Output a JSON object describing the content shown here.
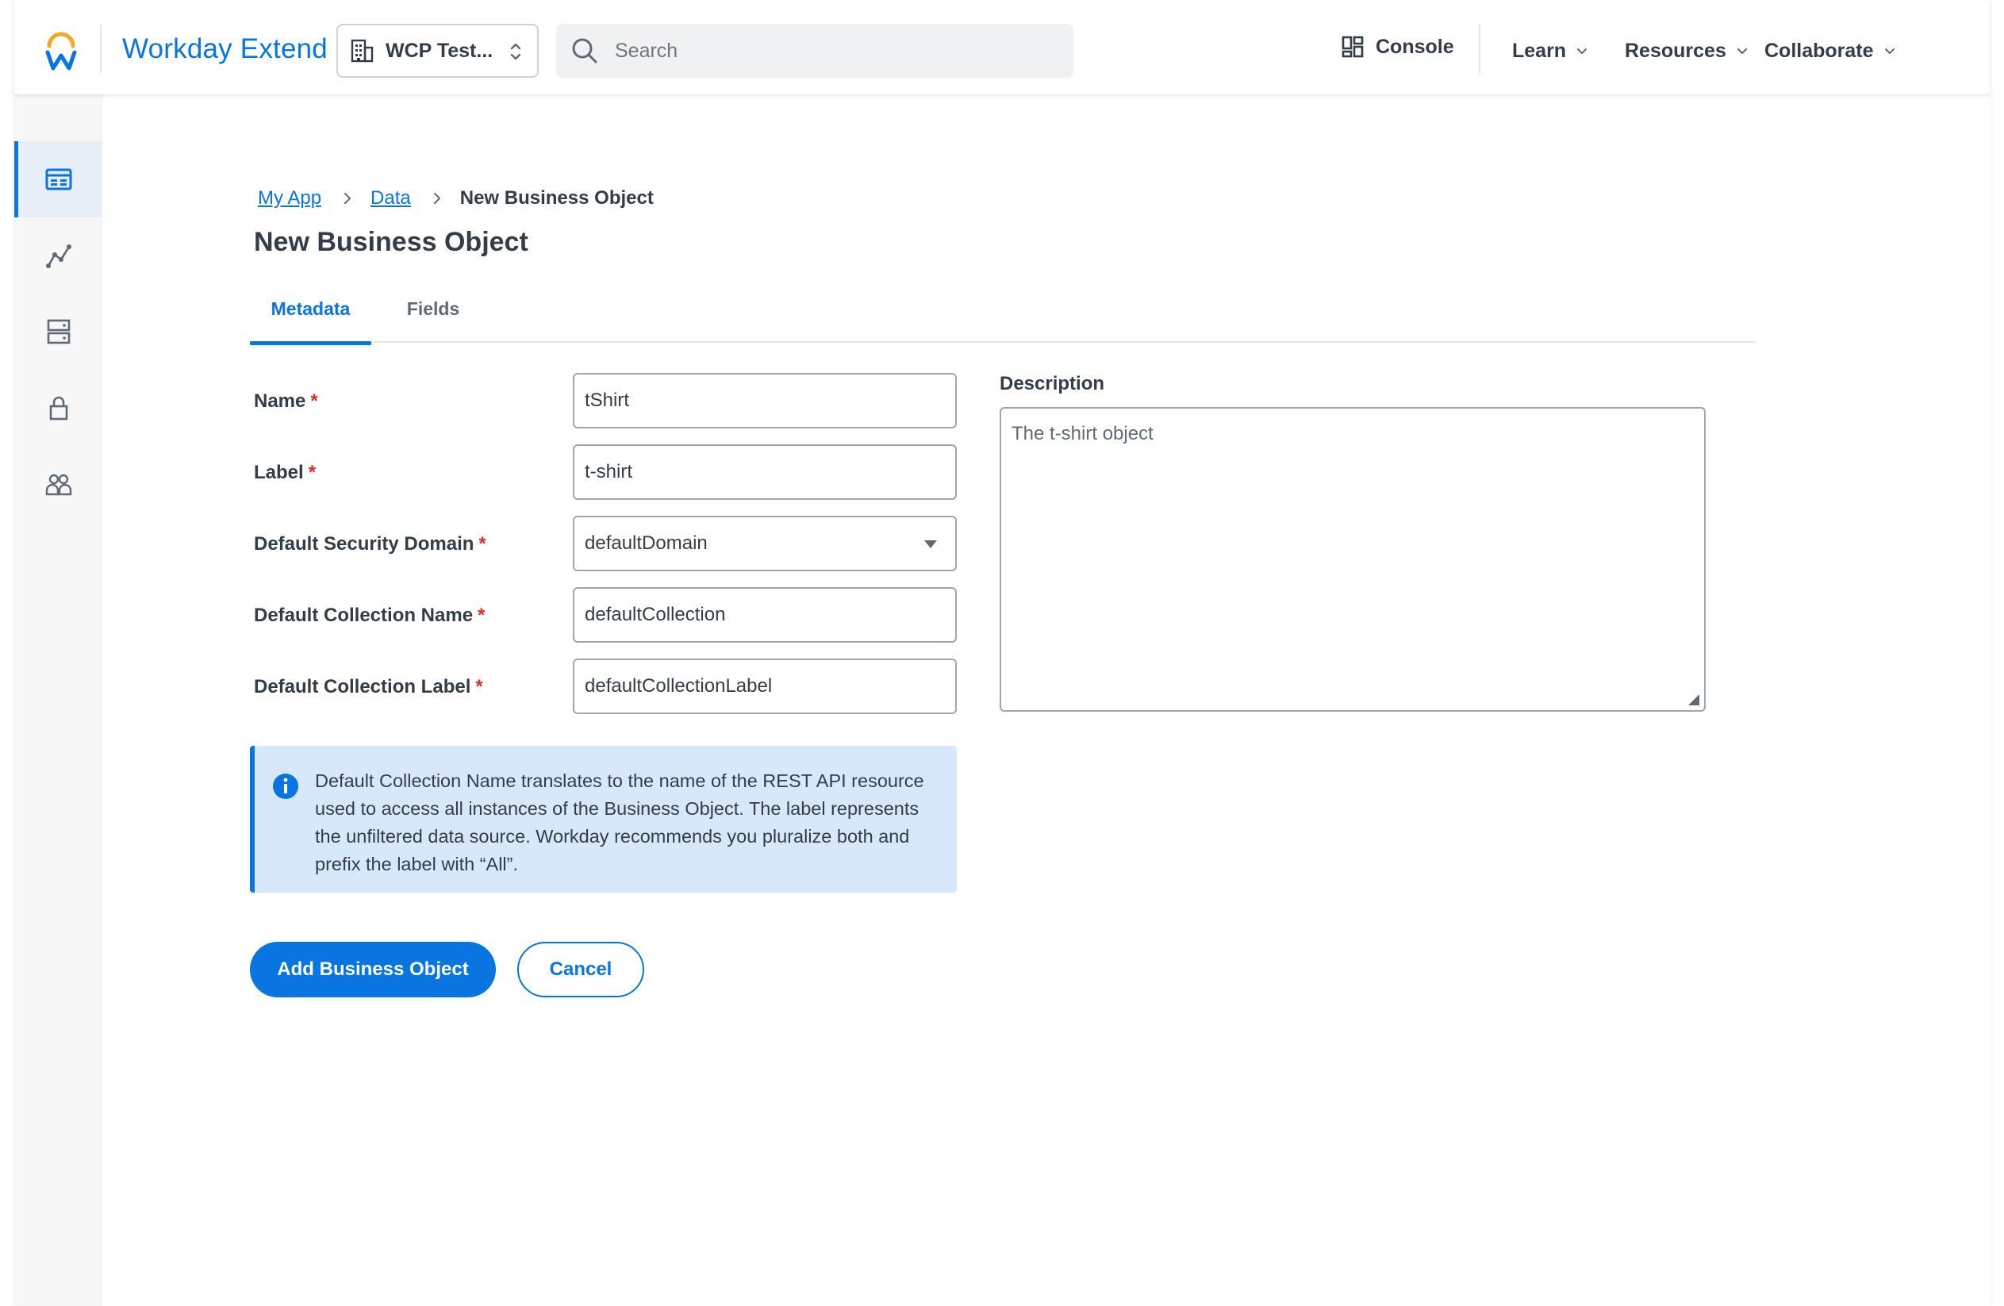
{
  "header": {
    "brand": "Workday Extend",
    "tenant": "WCP Test...",
    "search_placeholder": "Search",
    "console_label": "Console",
    "nav": [
      "Learn",
      "Resources",
      "Collaborate"
    ]
  },
  "sidebar": {
    "items": [
      {
        "icon": "app-data-icon",
        "active": true
      },
      {
        "icon": "analytics-icon",
        "active": false
      },
      {
        "icon": "server-icon",
        "active": false
      },
      {
        "icon": "lock-icon",
        "active": false
      },
      {
        "icon": "users-icon",
        "active": false
      }
    ]
  },
  "breadcrumb": {
    "items": [
      "My App",
      "Data"
    ],
    "current": "New Business Object"
  },
  "page": {
    "title": "New Business Object"
  },
  "tabs": [
    {
      "label": "Metadata",
      "active": true
    },
    {
      "label": "Fields",
      "active": false
    }
  ],
  "form": {
    "required_mark": "*",
    "name": {
      "label": "Name",
      "value": "tShirt"
    },
    "label": {
      "label": "Label",
      "value": "t-shirt"
    },
    "security_domain": {
      "label": "Default Security Domain",
      "value": "defaultDomain"
    },
    "collection_name": {
      "label": "Default Collection Name",
      "value": "defaultCollection"
    },
    "collection_label": {
      "label": "Default Collection Label",
      "value": "defaultCollectionLabel"
    },
    "description": {
      "label": "Description",
      "value": "The t-shirt object"
    }
  },
  "info": {
    "text": "Default Collection Name translates to the name of the REST API resource used to access all instances of the Business Object. The label represents the unfiltered data source. Workday recommends you pluralize both and prefix the label with “All”."
  },
  "actions": {
    "primary": "Add Business Object",
    "cancel": "Cancel"
  },
  "colors": {
    "accent": "#0875e1",
    "required": "#de2e21",
    "info_background": "#d7e8fb"
  }
}
